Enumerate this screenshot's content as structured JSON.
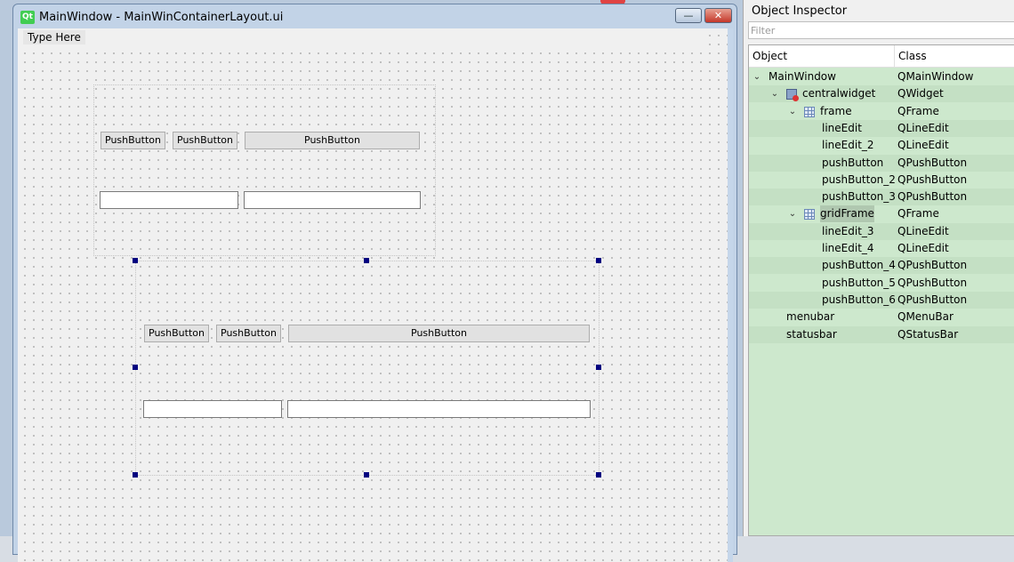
{
  "window": {
    "title": "MainWindow - MainWinContainerLayout.ui",
    "logo_text": "Qt",
    "minimize_glyph": "—",
    "close_glyph": "✕"
  },
  "menubar": {
    "placeholder_item": "Type Here"
  },
  "frame": {
    "buttons": [
      "PushButton",
      "PushButton",
      "PushButton"
    ]
  },
  "grid_frame": {
    "buttons": [
      "PushButton",
      "PushButton",
      "PushButton"
    ]
  },
  "inspector": {
    "title": "Object Inspector",
    "filter_placeholder": "Filter",
    "headers": {
      "object": "Object",
      "class": "Class"
    },
    "rows": [
      {
        "object": "MainWindow",
        "class": "QMainWindow",
        "expanded": true
      },
      {
        "object": "centralwidget",
        "class": "QWidget",
        "expanded": true,
        "icon": "widget-icon"
      },
      {
        "object": "frame",
        "class": "QFrame",
        "expanded": true,
        "icon": "layout-icon"
      },
      {
        "object": "lineEdit",
        "class": "QLineEdit"
      },
      {
        "object": "lineEdit_2",
        "class": "QLineEdit"
      },
      {
        "object": "pushButton",
        "class": "QPushButton"
      },
      {
        "object": "pushButton_2",
        "class": "QPushButton"
      },
      {
        "object": "pushButton_3",
        "class": "QPushButton"
      },
      {
        "object": "gridFrame",
        "class": "QFrame",
        "expanded": true,
        "icon": "layout-icon",
        "selected": true
      },
      {
        "object": "lineEdit_3",
        "class": "QLineEdit"
      },
      {
        "object": "lineEdit_4",
        "class": "QLineEdit"
      },
      {
        "object": "pushButton_4",
        "class": "QPushButton"
      },
      {
        "object": "pushButton_5",
        "class": "QPushButton"
      },
      {
        "object": "pushButton_6",
        "class": "QPushButton"
      },
      {
        "object": "menubar",
        "class": "QMenuBar"
      },
      {
        "object": "statusbar",
        "class": "QStatusBar"
      }
    ]
  }
}
